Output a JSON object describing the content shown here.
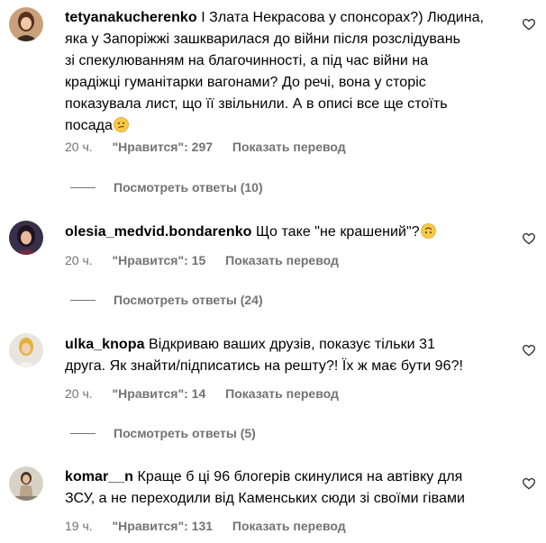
{
  "comments": [
    {
      "username": "tetyanakucherenko",
      "text_lines": [
        "І Злата Некрасова у спонсорах?) Людина,",
        "яка у Запоріжжі зашкварилася до війни після розслідувань",
        "зі спекулюванням на благочинності, а під час війни на",
        "крадіжці гуманітарки вагонами? До речі, вона у сторіс",
        "показувала лист, що її звільнили. А в описі все ще стоїть",
        "посада"
      ],
      "emoji": "confused-face",
      "time": "20 ч.",
      "likes": "\"Нравится\": 297",
      "translate": "Показать перевод",
      "replies": "Посмотреть ответы (10)"
    },
    {
      "username": "olesia_medvid.bondarenko",
      "text_lines": [
        "Що таке \"не крашений\"?"
      ],
      "emoji": "upside-down-face",
      "time": "20 ч.",
      "likes": "\"Нравится\": 15",
      "translate": "Показать перевод",
      "replies": "Посмотреть ответы (24)"
    },
    {
      "username": "ulka_knopa",
      "text_lines": [
        "Відкриваю ваших друзів, показує тільки 31",
        "друга. Як знайти/підписатись на решту?! Їх ж має бути 96?!"
      ],
      "emoji": "",
      "time": "20 ч.",
      "likes": "\"Нравится\": 14",
      "translate": "Показать перевод",
      "replies": "Посмотреть ответы (5)"
    },
    {
      "username": "komar__n",
      "text_lines": [
        "Краще б ці 96 блогерів скинулися на автівку для",
        "ЗСУ, а не переходили від Каменських сюди зі своїми гівами"
      ],
      "emoji": "",
      "time": "19 ч.",
      "likes": "\"Нравится\": 131",
      "translate": "Показать перевод",
      "replies": ""
    }
  ],
  "colors": {
    "text": "#000000",
    "secondary": "#737373",
    "emoji_yellow": "#f7c948"
  },
  "icons": {
    "like": "heart-outline-icon"
  }
}
